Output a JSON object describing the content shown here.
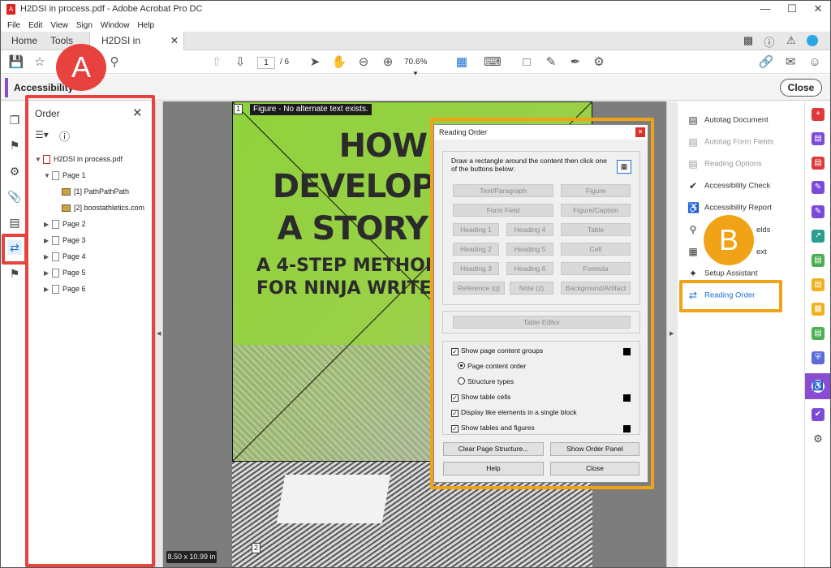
{
  "window": {
    "title": "H2DSI in process.pdf - Adobe Acrobat Pro DC",
    "menu": [
      "File",
      "Edit",
      "View",
      "Sign",
      "Window",
      "Help"
    ]
  },
  "tabs": {
    "home": "Home",
    "tools": "Tools",
    "document": "H2DSI in process.pdf"
  },
  "toolbar": {
    "page_current": "1",
    "page_total": "/ 6",
    "zoom": "70.6%"
  },
  "accessibility_bar": {
    "label": "Accessibility",
    "close": "Close"
  },
  "order_panel": {
    "title": "Order",
    "tree": {
      "root": "H2DSI in process.pdf",
      "page1": "Page 1",
      "page1_children": [
        "[1]  PathPathPath",
        "[2]  boostathletics.com"
      ],
      "pages": [
        "Page 2",
        "Page 3",
        "Page 4",
        "Page 5",
        "Page 6"
      ]
    }
  },
  "document": {
    "figure_tag": "Figure - No alternate text exists.",
    "page_marker_1": "1",
    "page_marker_2": "2",
    "headline": [
      "HOW TO",
      "DEVELOP + TEST",
      "A STORY IDEA"
    ],
    "subline": [
      "A 4-STEP METHOD",
      "FOR NINJA WRITERS"
    ],
    "page_size": "8.50 x 10.99 in"
  },
  "reading_order": {
    "title": "Reading Order",
    "instructions": "Draw a rectangle around the content then click one of the buttons below:",
    "buttons": {
      "text_paragraph": "Text/Paragraph",
      "figure": "Figure",
      "form_field": "Form Field",
      "figure_caption": "Figure/Caption",
      "heading1": "Heading 1",
      "heading4": "Heading 4",
      "table": "Table",
      "heading2": "Heading 2",
      "heading5": "Heading 5",
      "cell": "Cell",
      "heading3": "Heading 3",
      "heading6": "Heading 6",
      "formula": "Formula",
      "reference": "Reference (q)",
      "note": "Note (z)",
      "background": "Background/Artifact",
      "table_editor": "Table Editor"
    },
    "options": {
      "show_groups": "Show page content groups",
      "page_content_order": "Page content order",
      "structure_types": "Structure types",
      "show_table_cells": "Show table cells",
      "display_like": "Display like elements in a single block",
      "show_tables_figures": "Show tables and figures"
    },
    "footer": {
      "clear": "Clear Page Structure...",
      "show_order": "Show Order Panel",
      "help": "Help",
      "close": "Close"
    }
  },
  "tools_panel": {
    "items": [
      "Autotag Document",
      "Autotag Form Fields",
      "Reading Options",
      "Accessibility Check",
      "Accessibility Report",
      "elds",
      "ext",
      "Setup Assistant",
      "Reading Order"
    ]
  },
  "callouts": {
    "a": "A",
    "b": "B"
  },
  "colors": {
    "callout_red": "#e8423f",
    "callout_orange": "#f0a316",
    "accent_purple": "#8a4dd1",
    "link_blue": "#1d6fd6"
  }
}
